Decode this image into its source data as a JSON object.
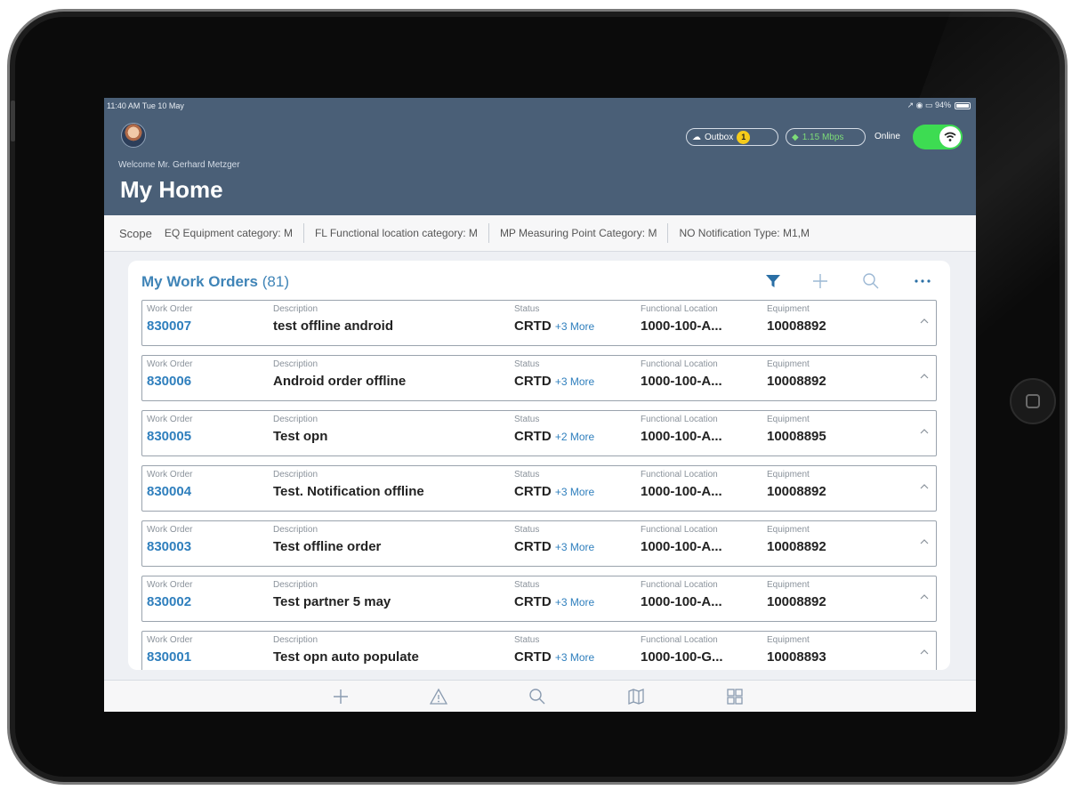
{
  "statusbar": {
    "time": "11:40 AM  Tue 10 May",
    "right": "↗ ◉ ▭ 94%"
  },
  "header": {
    "welcome": "Welcome Mr. Gerhard Metzger",
    "title": "My Home",
    "outbox_label": "Outbox",
    "outbox_count": "1",
    "speed": "1.15 Mbps",
    "online_label": "Online"
  },
  "scope": {
    "label": "Scope",
    "items": [
      "EQ Equipment category: M",
      "FL Functional location category: M",
      "MP Measuring Point Category: M",
      "NO Notification Type: M1,M"
    ]
  },
  "work_orders": {
    "title": "My Work Orders",
    "count": "(81)",
    "columns": {
      "work_order": "Work Order",
      "description": "Description",
      "status": "Status",
      "functional_location": "Functional Location",
      "equipment": "Equipment"
    },
    "rows": [
      {
        "id": "830007",
        "description": "test offline android",
        "status": "CRTD",
        "more": "+3 More",
        "functional_location": "1000-100-A...",
        "equipment": "10008892"
      },
      {
        "id": "830006",
        "description": "Android order offline",
        "status": "CRTD",
        "more": "+3 More",
        "functional_location": "1000-100-A...",
        "equipment": "10008892"
      },
      {
        "id": "830005",
        "description": "Test opn",
        "status": "CRTD",
        "more": "+2 More",
        "functional_location": "1000-100-A...",
        "equipment": "10008895"
      },
      {
        "id": "830004",
        "description": "Test. Notification offline",
        "status": "CRTD",
        "more": "+3 More",
        "functional_location": "1000-100-A...",
        "equipment": "10008892"
      },
      {
        "id": "830003",
        "description": "Test offline order",
        "status": "CRTD",
        "more": "+3 More",
        "functional_location": "1000-100-A...",
        "equipment": "10008892"
      },
      {
        "id": "830002",
        "description": "Test partner 5 may",
        "status": "CRTD",
        "more": "+3 More",
        "functional_location": "1000-100-A...",
        "equipment": "10008892"
      },
      {
        "id": "830001",
        "description": "Test opn auto populate",
        "status": "CRTD",
        "more": "+3 More",
        "functional_location": "1000-100-G...",
        "equipment": "10008893"
      }
    ]
  },
  "icons": {
    "filter": "filter-icon",
    "add": "plus-icon",
    "search": "search-icon",
    "more": "more-icon",
    "tabbar": [
      "plus-icon",
      "warning-icon",
      "search-icon",
      "map-icon",
      "grid-icon"
    ]
  },
  "colors": {
    "header_bg": "#4a5f77",
    "accent": "#2f7fbd",
    "online_toggle": "#3ddc52",
    "badge": "#f5cb1b"
  }
}
